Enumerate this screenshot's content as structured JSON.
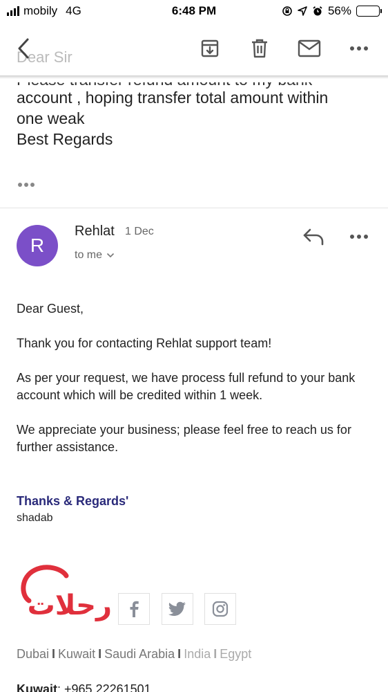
{
  "status_bar": {
    "carrier": "mobily",
    "network": "4G",
    "time": "6:48 PM",
    "battery": "56%",
    "battery_level": 0.56
  },
  "previous_message": {
    "greeting": "Dear Sir",
    "line1": "Please transfer refund amount to my bank",
    "line2": "account , hoping transfer total amount  within",
    "line3": "one weak",
    "line4": "Best Regards"
  },
  "toolbar": {
    "back_icon": "back-chevron",
    "archive_icon": "archive",
    "delete_icon": "trash",
    "mail_icon": "mail",
    "more_icon": "more-horizontal"
  },
  "message": {
    "avatar_letter": "R",
    "avatar_color": "#7b4fc8",
    "sender": "Rehlat",
    "date": "1 Dec",
    "recipient": "to me",
    "greeting": "Dear Guest,",
    "para1": "Thank you for contacting Rehlat support team!",
    "para2": "As per your request, we have process full refund to your bank account which will be credited within 1 week.",
    "para3": "We appreciate your business; please feel free to reach us for further assistance.",
    "thanks": "Thanks & Regards'",
    "signer": "shadab"
  },
  "signature": {
    "logo_text": "رحلات",
    "brand_color": "#e0303c",
    "locations": [
      "Dubai",
      "Kuwait",
      "Saudi Arabia",
      "India",
      "Egypt"
    ],
    "phone_label": "Kuwait",
    "phone_number": ": +965 22261501"
  }
}
